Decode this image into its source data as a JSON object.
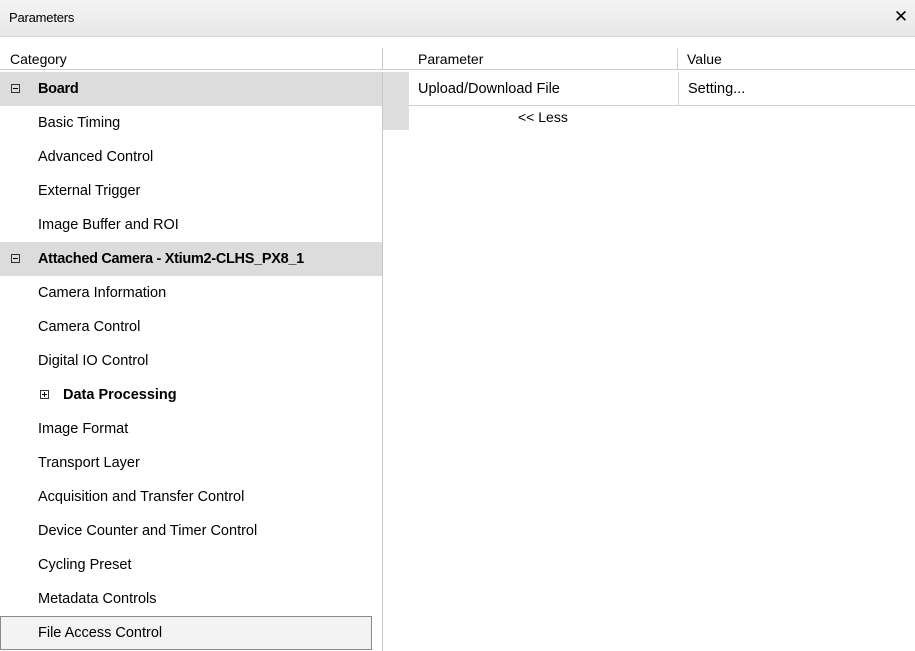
{
  "window": {
    "title": "Parameters",
    "close_glyph": "✕"
  },
  "columns": {
    "category": "Category",
    "parameter": "Parameter",
    "value": "Value"
  },
  "tree": {
    "board": {
      "label": "Board",
      "toggle": "minus"
    },
    "board_items": [
      "Basic Timing",
      "Advanced Control",
      "External Trigger",
      "Image Buffer and ROI"
    ],
    "camera": {
      "label": "Attached Camera - Xtium2-CLHS_PX8_1",
      "toggle": "minus"
    },
    "camera_items_a": [
      "Camera Information",
      "Camera Control",
      "Digital IO Control"
    ],
    "data_processing": {
      "label": "Data Processing",
      "toggle": "plus"
    },
    "camera_items_b": [
      "Image Format",
      "Transport Layer",
      "Acquisition and Transfer Control",
      "Device Counter and Timer Control",
      "Cycling Preset",
      "Metadata Controls"
    ],
    "selected": "File Access Control"
  },
  "parameters": [
    {
      "name": "Upload/Download File",
      "value": "Setting..."
    }
  ],
  "less_label": "<< Less"
}
